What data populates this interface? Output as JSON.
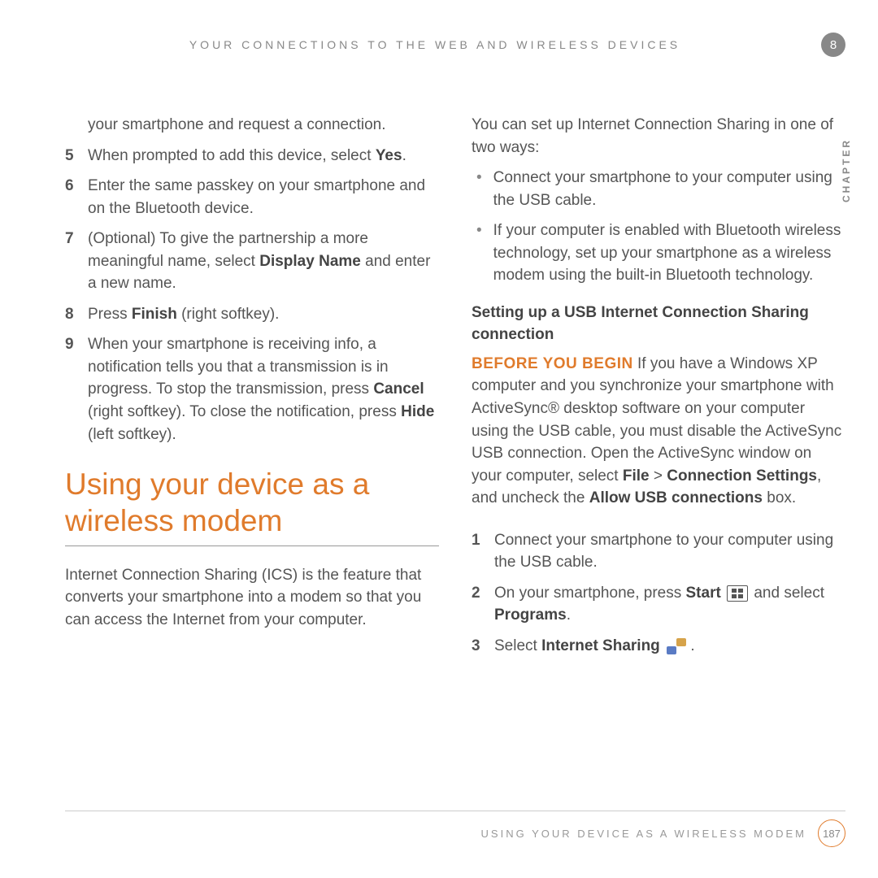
{
  "header": {
    "title": "YOUR CONNECTIONS TO THE WEB AND WIRELESS DEVICES",
    "chapter_number": "8",
    "chapter_label": "CHAPTER"
  },
  "left_column": {
    "intro_fragment": "your smartphone and request a connection.",
    "steps": [
      {
        "n": "5",
        "pre": "When prompted to add this device, select ",
        "b1": "Yes",
        "post": "."
      },
      {
        "n": "6",
        "pre": "Enter the same passkey on your smartphone and on the Bluetooth device.",
        "b1": "",
        "post": ""
      },
      {
        "n": "7",
        "pre": "(Optional) To give the partnership a more meaningful name, select ",
        "b1": "Display Name",
        "post": " and enter a new name."
      },
      {
        "n": "8",
        "pre": "Press ",
        "b1": "Finish",
        "post": " (right softkey)."
      },
      {
        "n": "9",
        "pre": "When your smartphone is receiving info, a notification tells you that a transmission is in progress. To stop the transmission, press ",
        "b1": "Cancel",
        "mid": " (right softkey). To close the notification, press ",
        "b2": "Hide",
        "post": " (left softkey)."
      }
    ],
    "heading": "Using your device as a wireless modem",
    "ics_para": "Internet Connection Sharing (ICS) is the feature that converts your smartphone into a modem so that you can access the Internet from your computer."
  },
  "right_column": {
    "intro": "You can set up Internet Connection Sharing in one of two ways:",
    "bullets": [
      "Connect your smartphone to your computer using the USB cable.",
      "If your computer is enabled with Bluetooth wireless technology, set up your smartphone as a wireless modem using the built-in Bluetooth technology."
    ],
    "sub_heading": "Setting up a USB Internet Connection Sharing connection",
    "before_label": "BEFORE YOU BEGIN",
    "before_text_pre": "  If you have a Windows XP computer and you synchronize your smartphone with ActiveSync® desktop software on your computer using the USB cable, you must disable the ActiveSync USB connection. Open the ActiveSync window on your computer, select ",
    "b1": "File",
    "gt": " > ",
    "b2": "Connection Settings",
    "mid": ", and uncheck the ",
    "b3": "Allow USB connections",
    "post": " box.",
    "steps": [
      {
        "n": "1",
        "pre": "Connect your smartphone to your computer using the USB cable.",
        "b1": "",
        "post": ""
      },
      {
        "n": "2",
        "pre": "On your smartphone, press ",
        "b1": "Start",
        "icon": "win",
        "mid": " and select ",
        "b2": "Programs",
        "post": "."
      },
      {
        "n": "3",
        "pre": "Select ",
        "b1": "Internet Sharing",
        "icon": "share",
        "post": " ."
      }
    ]
  },
  "footer": {
    "title": "USING YOUR DEVICE AS A WIRELESS MODEM",
    "page": "187"
  }
}
